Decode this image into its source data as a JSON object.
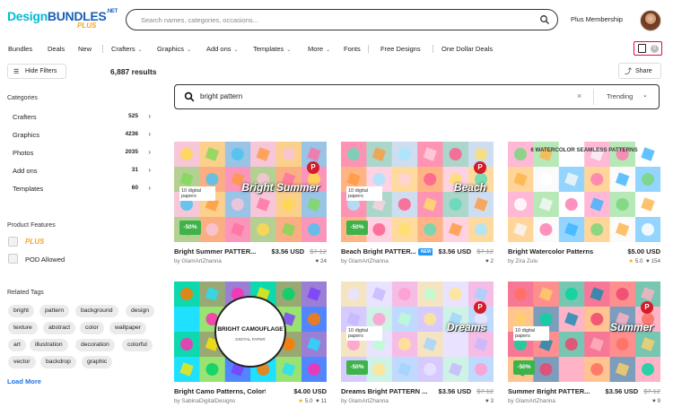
{
  "brand": {
    "logo_main": "DesignBUNDLES",
    "logo_tld": ".NET",
    "logo_plus": "PLUS"
  },
  "search": {
    "placeholder": "Search names, categories, occasions..."
  },
  "header": {
    "plus_membership": "Plus Membership"
  },
  "nav": [
    {
      "label": "Bundles",
      "chevron": false
    },
    {
      "label": "Deals",
      "chevron": false
    },
    {
      "label": "New",
      "chevron": false
    },
    {
      "label": "Crafters",
      "chevron": true
    },
    {
      "label": "Graphics",
      "chevron": true
    },
    {
      "label": "Add ons",
      "chevron": true
    },
    {
      "label": "Templates",
      "chevron": true
    },
    {
      "label": "More",
      "chevron": true
    },
    {
      "label": "Fonts",
      "chevron": false
    },
    {
      "label": "Free Designs",
      "chevron": false
    },
    {
      "label": "One Dollar Deals",
      "chevron": false
    }
  ],
  "cart": {
    "count": "0"
  },
  "toolbar": {
    "hide_filters": "Hide Filters",
    "results": "6,887 results",
    "share": "Share"
  },
  "sidebar": {
    "categories_title": "Categories",
    "categories": [
      {
        "name": "Crafters",
        "count": "525"
      },
      {
        "name": "Graphics",
        "count": "4236"
      },
      {
        "name": "Photos",
        "count": "2035"
      },
      {
        "name": "Add ons",
        "count": "31"
      },
      {
        "name": "Templates",
        "count": "60"
      }
    ],
    "features_title": "Product Features",
    "features": [
      {
        "label": "PLUS"
      },
      {
        "label": "POD Allowed"
      }
    ],
    "tags_title": "Related Tags",
    "tags": [
      "bright",
      "pattern",
      "background",
      "design",
      "texture",
      "abstract",
      "color",
      "wallpaper",
      "art",
      "illustration",
      "decoration",
      "colorful",
      "vector",
      "backdrop",
      "graphic"
    ],
    "load_more": "Load More"
  },
  "inner_search": {
    "value": "bright pattern",
    "sort": "Trending"
  },
  "products": [
    {
      "title": "Bright Summer PATTER...",
      "price": "$3.56 USD",
      "old_price": "$7.12",
      "author": "by GlamArtZhanna",
      "meta": "24",
      "meta_icon": "heart",
      "rating": "",
      "discount": "-50%",
      "is_new": false,
      "pinterest": true,
      "thumb_text": "Bright Summer",
      "thumb_sub": "10 digital papers"
    },
    {
      "title": "Beach Bright PATTER...",
      "price": "$3.56 USD",
      "old_price": "$7.12",
      "author": "by GlamArtZhanna",
      "meta": "2",
      "meta_icon": "heart",
      "rating": "",
      "discount": "-50%",
      "is_new": true,
      "new_label": "NEW",
      "pinterest": true,
      "thumb_text": "Beach",
      "thumb_sub": "10 digital papers"
    },
    {
      "title": "Bright Watercolor Patterns",
      "price": "$5.00 USD",
      "old_price": "",
      "author": "by Zira Zulu",
      "meta": "154",
      "meta_icon": "heart",
      "rating": "5.0",
      "discount": "",
      "is_new": false,
      "pinterest": false,
      "thumb_text": "6 WATERCOLOR SEAMLESS PATTERNS",
      "thumb_sub": ""
    },
    {
      "title": "Bright Camo Patterns, Colorful ...",
      "price": "$4.00 USD",
      "old_price": "",
      "author": "by SabinaDigitalDesigns",
      "meta": "11",
      "meta_icon": "heart",
      "rating": "5.0",
      "discount": "",
      "is_new": false,
      "pinterest": false,
      "thumb_text": "BRIGHT CAMOUFLAGE",
      "thumb_sub": "DIGITAL PAPER"
    },
    {
      "title": "Dreams Bright PATTERN ...",
      "price": "$3.56 USD",
      "old_price": "$7.12",
      "author": "by GlamArtZhanna",
      "meta": "3",
      "meta_icon": "heart",
      "rating": "",
      "discount": "-50%",
      "is_new": false,
      "pinterest": true,
      "thumb_text": "Dreams",
      "thumb_sub": "10 digital papers"
    },
    {
      "title": "Summer Bright PATTER...",
      "price": "$3.56 USD",
      "old_price": "$7.12",
      "author": "by GlamArtZhanna",
      "meta": "9",
      "meta_icon": "heart",
      "rating": "",
      "discount": "-50%",
      "is_new": false,
      "pinterest": true,
      "thumb_text": "Summer",
      "thumb_sub": "10 digital papers"
    }
  ],
  "colors": {
    "accent_blue": "#1a73e8",
    "discount_green": "#3db34a",
    "pinterest_red": "#d31d2a",
    "plus_orange": "#f5a623"
  }
}
